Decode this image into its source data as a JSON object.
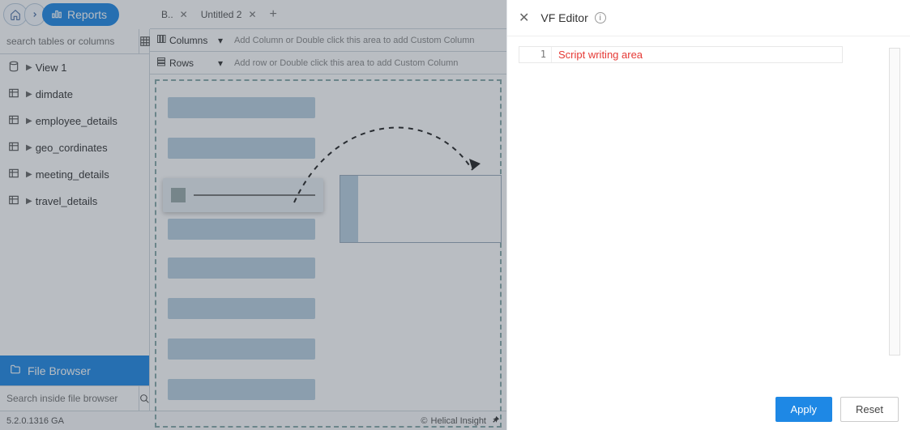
{
  "breadcrumb": {
    "reports": "Reports"
  },
  "sidebar": {
    "search_placeholder": "search tables or columns",
    "items": [
      {
        "label": "View 1"
      },
      {
        "label": "dimdate"
      },
      {
        "label": "employee_details"
      },
      {
        "label": "geo_cordinates"
      },
      {
        "label": "meeting_details"
      },
      {
        "label": "travel_details"
      }
    ],
    "filebrowser_label": "File Browser",
    "filebrowser_search_placeholder": "Search inside file browser"
  },
  "status": {
    "version": "5.2.0.1316 GA",
    "brand": "Helical Insight"
  },
  "tabs": {
    "t1": "B..",
    "t2": "Untitled 2"
  },
  "config": {
    "columns_label": "Columns",
    "columns_hint": "Add Column or Double click this area to add Custom Column",
    "rows_label": "Rows",
    "rows_hint": "Add row or Double click this area to add Custom Column"
  },
  "drawer": {
    "title": "VF Editor",
    "line_number": "1",
    "script_hint": "Script writing area",
    "apply": "Apply",
    "reset": "Reset"
  }
}
